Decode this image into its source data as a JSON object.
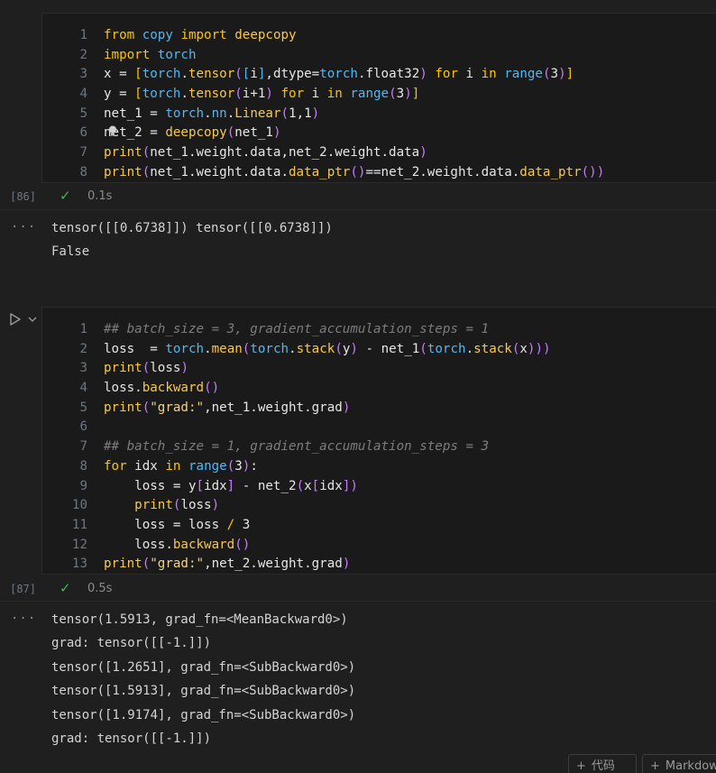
{
  "cell1": {
    "exec_count": "[86]",
    "duration": "0.1s",
    "lines": [
      {
        "n": "1",
        "tokens": [
          [
            "kw",
            "from"
          ],
          [
            "pl",
            " "
          ],
          [
            "id",
            "copy"
          ],
          [
            "pl",
            " "
          ],
          [
            "kw",
            "import"
          ],
          [
            "pl",
            " "
          ],
          [
            "fn",
            "deepcopy"
          ]
        ]
      },
      {
        "n": "2",
        "tokens": [
          [
            "kw",
            "import"
          ],
          [
            "pl",
            " "
          ],
          [
            "id",
            "torch"
          ]
        ]
      },
      {
        "n": "3",
        "tokens": [
          [
            "pl",
            "x = "
          ],
          [
            "kw",
            "["
          ],
          [
            "id",
            "torch"
          ],
          [
            "pl",
            "."
          ],
          [
            "fn",
            "tensor"
          ],
          [
            "br",
            "("
          ],
          [
            "id",
            "["
          ],
          [
            "pl",
            "i"
          ],
          [
            "id",
            "]"
          ],
          [
            "pl",
            ",dtype="
          ],
          [
            "id",
            "torch"
          ],
          [
            "pl",
            ".float32"
          ],
          [
            "br",
            ")"
          ],
          [
            "pl",
            " "
          ],
          [
            "kw",
            "for"
          ],
          [
            "pl",
            " i "
          ],
          [
            "kw",
            "in"
          ],
          [
            "pl",
            " "
          ],
          [
            "id",
            "range"
          ],
          [
            "br",
            "("
          ],
          [
            "nm",
            "3"
          ],
          [
            "br",
            ")"
          ],
          [
            "kw",
            "]"
          ]
        ]
      },
      {
        "n": "4",
        "tokens": [
          [
            "pl",
            "y = "
          ],
          [
            "kw",
            "["
          ],
          [
            "id",
            "torch"
          ],
          [
            "pl",
            "."
          ],
          [
            "fn",
            "tensor"
          ],
          [
            "br",
            "("
          ],
          [
            "pl",
            "i+1"
          ],
          [
            "br",
            ")"
          ],
          [
            "pl",
            " "
          ],
          [
            "kw",
            "for"
          ],
          [
            "pl",
            " i "
          ],
          [
            "kw",
            "in"
          ],
          [
            "pl",
            " "
          ],
          [
            "id",
            "range"
          ],
          [
            "br",
            "("
          ],
          [
            "nm",
            "3"
          ],
          [
            "br",
            ")"
          ],
          [
            "kw",
            "]"
          ]
        ]
      },
      {
        "n": "5",
        "tokens": [
          [
            "pl",
            "net_1 = "
          ],
          [
            "id",
            "torch"
          ],
          [
            "pl",
            "."
          ],
          [
            "id",
            "nn"
          ],
          [
            "pl",
            "."
          ],
          [
            "fn",
            "Linear"
          ],
          [
            "br",
            "("
          ],
          [
            "nm",
            "1,1"
          ],
          [
            "br",
            ")"
          ]
        ]
      },
      {
        "n": "6",
        "tokens": [
          [
            "pl",
            "net_2 = "
          ],
          [
            "fn",
            "deepcopy"
          ],
          [
            "br",
            "("
          ],
          [
            "pl",
            "net_1"
          ],
          [
            "br",
            ")"
          ]
        ]
      },
      {
        "n": "7",
        "tokens": [
          [
            "fn",
            "print"
          ],
          [
            "br",
            "("
          ],
          [
            "pl",
            "net_1.weight.data,net_2.weight.data"
          ],
          [
            "br",
            ")"
          ]
        ]
      },
      {
        "n": "8",
        "tokens": [
          [
            "fn",
            "print"
          ],
          [
            "br",
            "("
          ],
          [
            "pl",
            "net_1.weight.data."
          ],
          [
            "fn",
            "data_ptr"
          ],
          [
            "br",
            "()"
          ],
          [
            "pl",
            "==net_2.weight.data."
          ],
          [
            "fn",
            "data_ptr"
          ],
          [
            "br",
            "())"
          ]
        ]
      }
    ],
    "output": [
      "tensor([[0.6738]]) tensor([[0.6738]])",
      "False"
    ]
  },
  "cell2": {
    "exec_count": "[87]",
    "duration": "0.5s",
    "lines": [
      {
        "n": "1",
        "tokens": [
          [
            "cm",
            "## batch_size = 3, gradient_accumulation_steps = 1"
          ]
        ]
      },
      {
        "n": "2",
        "tokens": [
          [
            "pl",
            "loss  = "
          ],
          [
            "id",
            "torch"
          ],
          [
            "pl",
            "."
          ],
          [
            "fn",
            "mean"
          ],
          [
            "br",
            "("
          ],
          [
            "id",
            "torch"
          ],
          [
            "pl",
            "."
          ],
          [
            "fn",
            "stack"
          ],
          [
            "br",
            "("
          ],
          [
            "pl",
            "y"
          ],
          [
            "br",
            ")"
          ],
          [
            "pl",
            " - net_1"
          ],
          [
            "br",
            "("
          ],
          [
            "id",
            "torch"
          ],
          [
            "pl",
            "."
          ],
          [
            "fn",
            "stack"
          ],
          [
            "br",
            "("
          ],
          [
            "pl",
            "x"
          ],
          [
            "br",
            ")))"
          ]
        ]
      },
      {
        "n": "3",
        "tokens": [
          [
            "fn",
            "print"
          ],
          [
            "br",
            "("
          ],
          [
            "pl",
            "loss"
          ],
          [
            "br",
            ")"
          ]
        ]
      },
      {
        "n": "4",
        "tokens": [
          [
            "pl",
            "loss."
          ],
          [
            "fn",
            "backward"
          ],
          [
            "br",
            "()"
          ]
        ]
      },
      {
        "n": "5",
        "tokens": [
          [
            "fn",
            "print"
          ],
          [
            "br",
            "("
          ],
          [
            "st",
            "\"grad:\""
          ],
          [
            "pl",
            ",net_1.weight.grad"
          ],
          [
            "br",
            ")"
          ]
        ]
      },
      {
        "n": "6",
        "tokens": []
      },
      {
        "n": "7",
        "tokens": [
          [
            "cm",
            "## batch_size = 1, gradient_accumulation_steps = 3"
          ]
        ]
      },
      {
        "n": "8",
        "tokens": [
          [
            "kw",
            "for"
          ],
          [
            "pl",
            " idx "
          ],
          [
            "kw",
            "in"
          ],
          [
            "pl",
            " "
          ],
          [
            "id",
            "range"
          ],
          [
            "br",
            "("
          ],
          [
            "nm",
            "3"
          ],
          [
            "br",
            ")"
          ],
          [
            "pl",
            ":"
          ]
        ]
      },
      {
        "n": "9",
        "tokens": [
          [
            "pl",
            "    loss = y"
          ],
          [
            "br",
            "["
          ],
          [
            "pl",
            "idx"
          ],
          [
            "br",
            "]"
          ],
          [
            "pl",
            " - net_2"
          ],
          [
            "br",
            "("
          ],
          [
            "pl",
            "x"
          ],
          [
            "br",
            "["
          ],
          [
            "pl",
            "idx"
          ],
          [
            "br",
            "])"
          ]
        ]
      },
      {
        "n": "10",
        "tokens": [
          [
            "pl",
            "    "
          ],
          [
            "fn",
            "print"
          ],
          [
            "br",
            "("
          ],
          [
            "pl",
            "loss"
          ],
          [
            "br",
            ")"
          ]
        ]
      },
      {
        "n": "11",
        "tokens": [
          [
            "pl",
            "    loss = loss "
          ],
          [
            "kw",
            "/"
          ],
          [
            "pl",
            " "
          ],
          [
            "nm",
            "3"
          ]
        ]
      },
      {
        "n": "12",
        "tokens": [
          [
            "pl",
            "    loss."
          ],
          [
            "fn",
            "backward"
          ],
          [
            "br",
            "()"
          ]
        ]
      },
      {
        "n": "13",
        "tokens": [
          [
            "fn",
            "print"
          ],
          [
            "br",
            "("
          ],
          [
            "st",
            "\"grad:\""
          ],
          [
            "pl",
            ",net_2.weight.grad"
          ],
          [
            "br",
            ")"
          ]
        ]
      }
    ],
    "output": [
      "tensor(1.5913, grad_fn=<MeanBackward0>)",
      "grad: tensor([[-1.]])",
      "tensor([1.2651], grad_fn=<SubBackward0>)",
      "tensor([1.5913], grad_fn=<SubBackward0>)",
      "tensor([1.9174], grad_fn=<SubBackward0>)",
      "grad: tensor([[-1.]])"
    ]
  },
  "output_menu_glyph": "···",
  "check_glyph": "✓",
  "toolbar": {
    "add_code_label": "代码",
    "add_markdown_label": "Markdown",
    "plus_glyph": "+"
  },
  "colors": {
    "background": "#1f1f1f",
    "cell_background": "#1a1a1a",
    "success": "#3fb950"
  }
}
